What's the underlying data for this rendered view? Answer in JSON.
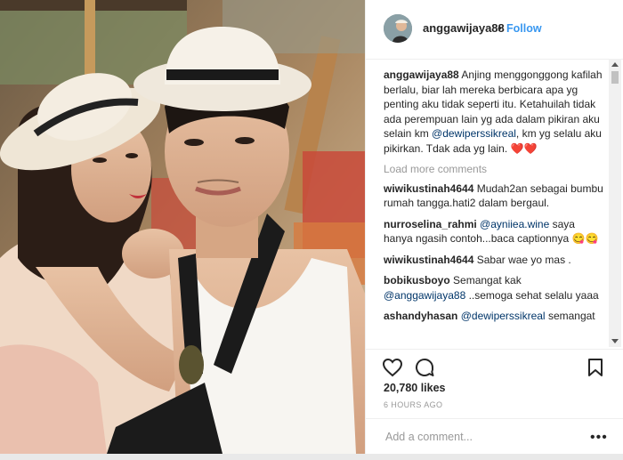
{
  "post": {
    "username": "anggawijaya88",
    "follow_label": "Follow",
    "separator": "•",
    "caption": {
      "text_1": "Anjing menggonggong kafilah berlalu, biar lah mereka berbicara apa yg penting aku tidak seperti itu. Ketahuilah tidak ada perempuan lain yg ada dalam pikiran aku selain km ",
      "mention": "@dewiperssikreal",
      "text_2": ", km yg selalu aku pikirkan. Tdak ada yg lain. ",
      "hearts": "❤️❤️"
    },
    "load_more": "Load more comments",
    "comments": [
      {
        "user": "wiwikustinah4644",
        "text": "Mudah2an sebagai bumbu rumah tangga.hati2 dalam bergaul."
      },
      {
        "user": "nurroselina_rahmi",
        "mention": "@ayniiea.wine",
        "text": " saya hanya ngasih contoh...baca captionnya",
        "emoji": "😋😋"
      },
      {
        "user": "wiwikustinah4644",
        "text": "Sabar wae yo mas ."
      },
      {
        "user": "bobikusboyo",
        "text": "Semangat kak ",
        "mention": "@anggawijaya88",
        "text_2": " ..semoga sehat selalu yaaa"
      },
      {
        "user": "ashandyhasan",
        "mention": "@dewiperssikreal",
        "text": " semangat"
      }
    ],
    "likes": "20,780 likes",
    "timestamp": "6 HOURS AGO",
    "add_comment_placeholder": "Add a comment...",
    "more_options": "•••"
  },
  "icons": {
    "like": "heart-icon",
    "comment": "comment-icon",
    "save": "bookmark-icon"
  },
  "colors": {
    "link": "#3897f0",
    "mention": "#003569",
    "text": "#262626",
    "muted": "#999999"
  }
}
